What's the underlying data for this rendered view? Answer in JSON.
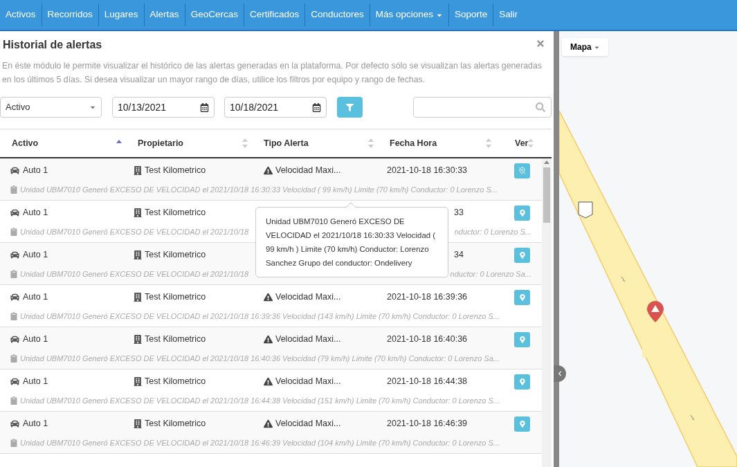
{
  "nav": {
    "items": [
      {
        "label": "Activos",
        "dropdown": false
      },
      {
        "label": "Recorridos",
        "dropdown": false
      },
      {
        "label": "Lugares",
        "dropdown": false
      },
      {
        "label": "Alertas",
        "dropdown": false
      },
      {
        "label": "GeoCercas",
        "dropdown": false
      },
      {
        "label": "Certificados",
        "dropdown": false
      },
      {
        "label": "Conductores",
        "dropdown": false
      },
      {
        "label": "Más opciones",
        "dropdown": true
      },
      {
        "label": "Soporte",
        "dropdown": false
      },
      {
        "label": "Salir",
        "dropdown": false
      }
    ]
  },
  "panel": {
    "title": "Historial de alertas",
    "description": "En éste módulo le permite visualizar el histórico de las alertas generadas en la plataforma. Por defecto sólo se visualizan las alertas generadas en los últimos 5 días. Si desea visualizar un mayor rango de días, utilice los filtros por equipo y rango de fechas."
  },
  "filters": {
    "asset": "Activo",
    "date_from": "10/13/2021",
    "date_to": "10/18/2021"
  },
  "columns": [
    {
      "label": "Activo",
      "sorted": true
    },
    {
      "label": "Propietario",
      "sorted": false
    },
    {
      "label": "Tipo Alerta",
      "sorted": false
    },
    {
      "label": "Fecha Hora",
      "sorted": false
    },
    {
      "label": "Ver",
      "sorted": false
    }
  ],
  "rows": [
    {
      "activo": "Auto 1",
      "propietario": "Test Kilometrico",
      "tipo": "Velocidad Maxi...",
      "fecha": "2021-10-18 16:30:33",
      "detail": "Unidad UBM7010 Generó EXCESO DE VELOCIDAD el 2021/10/18 16:30:33 Velocidad ( 99  km/h) Limite (70 km/h) Conductor: 0 Lorenzo S...",
      "located": false
    },
    {
      "activo": "Auto 1",
      "propietario": "Test Kilometrico",
      "fecha": "33",
      "detail": "Unidad UBM7010 Generó EXCESO DE VELOCIDAD el 2021/10/18",
      "detail_tail": "nductor: 0 Lorenzo S...",
      "located": true
    },
    {
      "activo": "Auto 1",
      "propietario": "Test Kilometrico",
      "fecha": "34",
      "detail": "Unidad UBM7010 Generó EXCESO DE VELOCIDAD el 2021/10/18",
      "detail_tail": "nductor: 0 Lorenzo Sa...",
      "located": true
    },
    {
      "activo": "Auto 1",
      "propietario": "Test Kilometrico",
      "tipo": "Velocidad Maxi...",
      "fecha": "2021-10-18 16:39:36",
      "detail": "Unidad UBM7010 Generó EXCESO DE VELOCIDAD el 2021/10/18 16:39:36 Velocidad (143 km/h) Limite (70 km/h) Conductor: 0 Lorenzo S...",
      "located": true
    },
    {
      "activo": "Auto 1",
      "propietario": "Test Kilometrico",
      "tipo": "Velocidad Maxi...",
      "fecha": "2021-10-18 16:40:36",
      "detail": "Unidad UBM7010 Generó EXCESO DE VELOCIDAD el 2021/10/18 16:40:36 Velocidad (79 km/h) Limite (70 km/h) Conductor: 0 Lorenzo Sa...",
      "located": true
    },
    {
      "activo": "Auto 1",
      "propietario": "Test Kilometrico",
      "tipo": "Velocidad Maxi...",
      "fecha": "2021-10-18 16:44:38",
      "detail": "Unidad UBM7010 Generó EXCESO DE VELOCIDAD el 2021/10/18 16:44:38 Velocidad (151 km/h) Limite (70 km/h) Conductor: 0 Lorenzo S...",
      "located": true
    },
    {
      "activo": "Auto 1",
      "propietario": "Test Kilometrico",
      "tipo": "Velocidad Maxi...",
      "fecha": "2021-10-18 16:46:39",
      "detail": "Unidad UBM7010 Generó EXCESO DE VELOCIDAD el 2021/10/18 16:46:39 Velocidad (104 km/h) Limite (70 km/h) Conductor: 0 Lorenzo S...",
      "located": true
    }
  ],
  "tooltip": {
    "text": "Unidad UBM7010 Generó EXCESO DE VELOCIDAD el 2021/10/18 16:30:33 Velocidad ( 99 km/h ) Limite (70 km/h) Conductor: Lorenzo Sanchez Grupo del conductor: Ondelivery"
  },
  "map": {
    "layer_button": "Mapa"
  }
}
